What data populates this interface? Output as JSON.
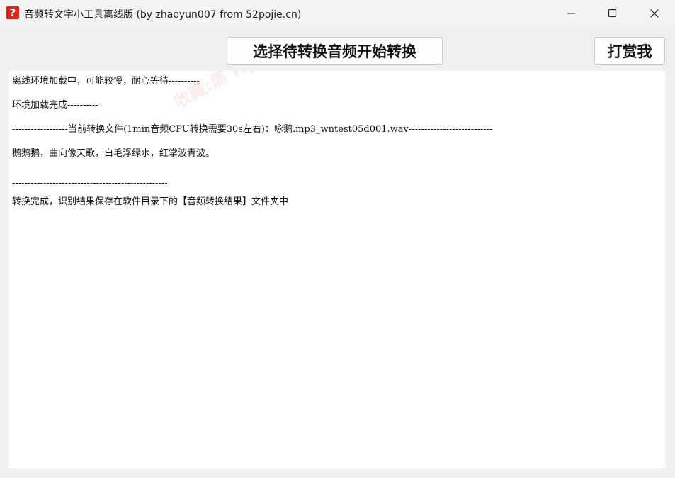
{
  "window": {
    "title": "音频转文字小工具离线版 (by zhaoyun007 from 52pojie.cn)",
    "icon": "question-mark-icon",
    "accent_color": "#e0221b"
  },
  "toolbar": {
    "convert_label": "选择待转换音频开始转换",
    "tip_label": "打赏我"
  },
  "log": {
    "lines": [
      "离线环境加载中，可能较慢，耐心等待----------",
      "环境加载完成----------",
      "------------------当前转换文件(1min音频CPU转换需要30s左右)：咏鹅.mp3_wntest05d001.wav---------------------------",
      "鹅鹅鹅，曲向像天歌，白毛浮绿水，红掌波青波。",
      "--------------------------------------------------",
      "转换完成，识别结果保存在软件目录下的【音频转换结果】文件夹中"
    ]
  },
  "watermark": {
    "text_a": "收藏:黑",
    "text_b": "Hybase"
  }
}
